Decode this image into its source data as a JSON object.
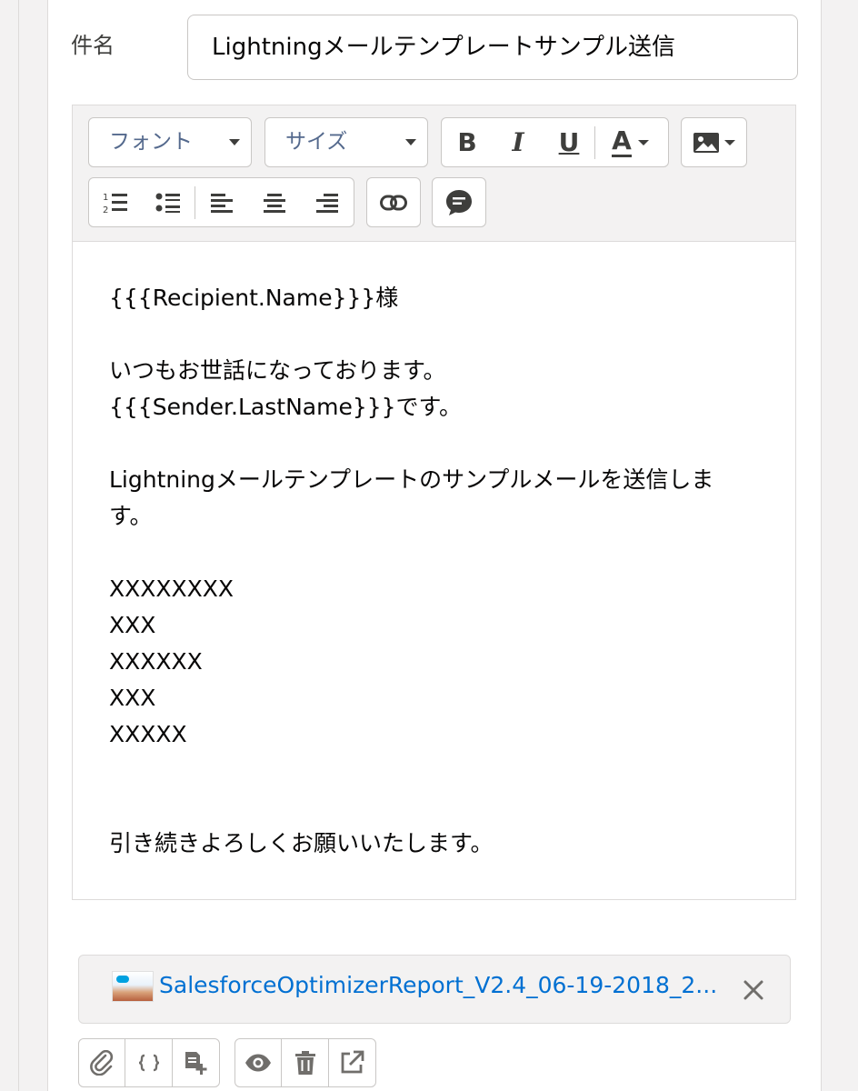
{
  "subject": {
    "label": "件名",
    "value": "Lightningメールテンプレートサンプル送信"
  },
  "toolbar": {
    "font_select": "フォント",
    "size_select": "サイズ",
    "bold_label": "B",
    "italic_label": "I",
    "underline_label": "U",
    "text_color_label": "A"
  },
  "editor": {
    "body": "{{{Recipient.Name}}}様\n\nいつもお世話になっております。\n{{{Sender.LastName}}}です。\n\nLightningメールテンプレートのサンプルメールを送信しま\nす。\n\nXXXXXXXX\nXXX\nXXXXXX\nXXX\nXXXXX\n\n\n引き続きよろしくお願いいたします。"
  },
  "attachment": {
    "file_name": "SalesforceOptimizerReport_V2.4_06-19-2018_2..."
  },
  "colors": {
    "link": "#0070d2",
    "border": "#c9c7c5",
    "toolbar_bg": "#f3f2f2"
  }
}
